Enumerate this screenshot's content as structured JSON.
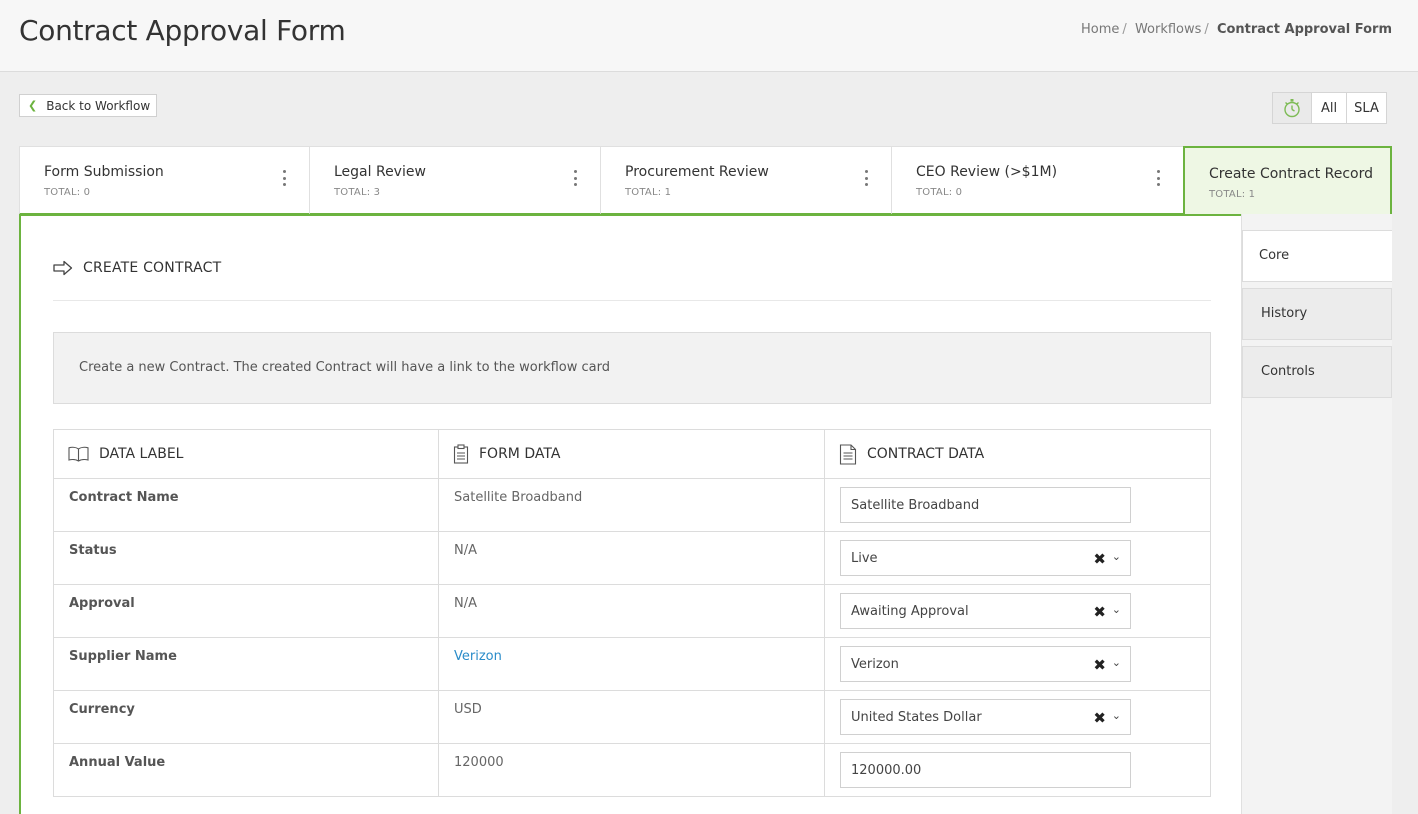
{
  "header": {
    "title": "Contract Approval Form",
    "breadcrumb": [
      "Home",
      "Workflows",
      "Contract Approval Form"
    ]
  },
  "toolbar": {
    "back_label": "Back to Workflow",
    "filter_all": "All",
    "filter_sla": "SLA"
  },
  "stages": [
    {
      "name": "Form Submission",
      "total": "TOTAL: 0"
    },
    {
      "name": "Legal Review",
      "total": "TOTAL: 3"
    },
    {
      "name": "Procurement Review",
      "total": "TOTAL: 1"
    },
    {
      "name": "CEO Review (>$1M)",
      "total": "TOTAL: 0"
    },
    {
      "name": "Create Contract Record",
      "total": "TOTAL: 1"
    }
  ],
  "panel": {
    "heading": "CREATE CONTRACT",
    "info": "Create a new Contract. The created Contract will have a link to the workflow card"
  },
  "table": {
    "headers": {
      "label": "DATA LABEL",
      "form": "FORM DATA",
      "contract": "CONTRACT DATA"
    },
    "rows": [
      {
        "label": "Contract Name",
        "form": "Satellite Broadband",
        "contract": "Satellite Broadband"
      },
      {
        "label": "Status",
        "form": "N/A",
        "contract": "Live"
      },
      {
        "label": "Approval",
        "form": "N/A",
        "contract": "Awaiting Approval"
      },
      {
        "label": "Supplier Name",
        "form": "Verizon",
        "contract": "Verizon"
      },
      {
        "label": "Currency",
        "form": "USD",
        "contract": "United States Dollar"
      },
      {
        "label": "Annual Value",
        "form": "120000",
        "contract": "120000.00"
      }
    ]
  },
  "side_tabs": [
    "Core",
    "History",
    "Controls"
  ],
  "colors": {
    "accent": "#6cb33f",
    "link": "#2a8cc9"
  }
}
